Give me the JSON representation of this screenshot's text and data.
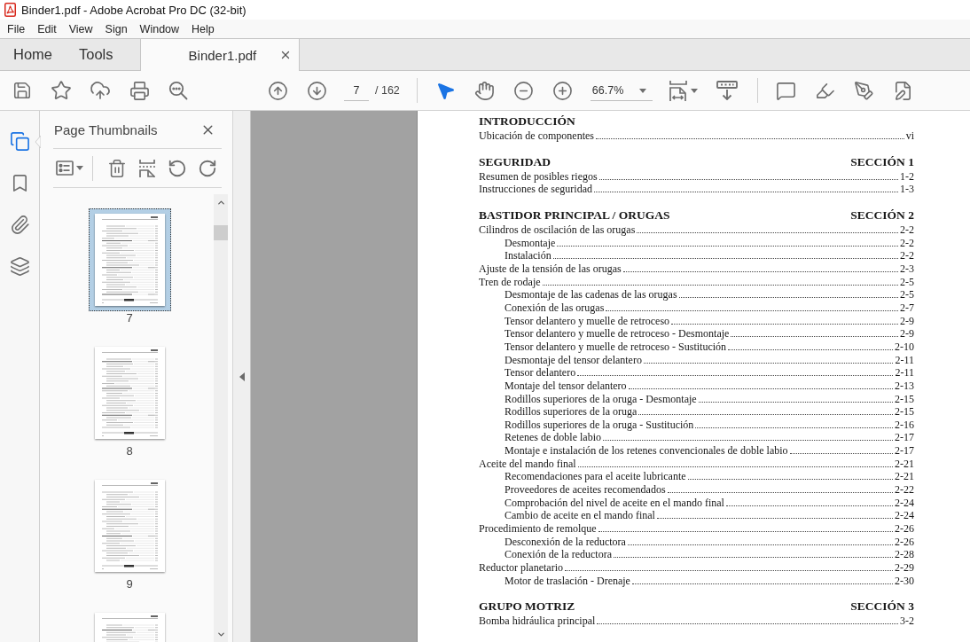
{
  "window": {
    "title": "Binder1.pdf - Adobe Acrobat Pro DC (32-bit)"
  },
  "menu": [
    "File",
    "Edit",
    "View",
    "Sign",
    "Window",
    "Help"
  ],
  "tabs": [
    {
      "label": "Home",
      "kind": "app",
      "selected": false
    },
    {
      "label": "Tools",
      "kind": "app",
      "selected": false
    },
    {
      "label": "Binder1.pdf",
      "kind": "document",
      "selected": true
    }
  ],
  "toolbar": {
    "tools": [
      {
        "selected": true
      },
      {
        "selected": false
      }
    ],
    "page_field": {
      "value": "7"
    },
    "page_total": "/ 162",
    "zoom_field": {
      "value": "66.7%"
    }
  },
  "nav_rail": [
    {
      "selected": true
    },
    {
      "selected": false
    },
    {
      "selected": false
    },
    {
      "selected": false
    }
  ],
  "thumbnails_panel": {
    "title": "Page Thumbnails",
    "thumbnails": [
      {
        "label": "7",
        "selected": true
      },
      {
        "label": "8",
        "selected": false
      },
      {
        "label": "9",
        "selected": false
      },
      {
        "selected": false
      }
    ]
  },
  "document": {
    "sections": [
      {
        "title": "INTRODUCCIÓN",
        "entries": [
          {
            "text": "Ubicación de componentes",
            "page": "vi"
          }
        ]
      },
      {
        "title": "SEGURIDAD",
        "number": "SECCIÓN 1",
        "entries": [
          {
            "text": "Resumen de posibles riegos",
            "page": "1-2"
          },
          {
            "text": "Instrucciones de seguridad",
            "page": "1-3"
          }
        ]
      },
      {
        "title": "BASTIDOR PRINCIPAL / ORUGAS",
        "number": "SECCIÓN 2",
        "entries": [
          {
            "text": "Cilindros de oscilación de las orugas",
            "page": "2-2",
            "children": [
              {
                "text": "Desmontaje",
                "page": "2-2"
              },
              {
                "text": "Instalación",
                "page": "2-2"
              }
            ]
          },
          {
            "text": "Ajuste de la tensión de las orugas",
            "page": "2-3"
          },
          {
            "text": "Tren de rodaje",
            "page": "2-5",
            "children": [
              {
                "text": "Desmontaje de las cadenas de las orugas",
                "page": "2-5"
              },
              {
                "text": "Conexión de las orugas",
                "page": "2-7"
              },
              {
                "text": "Tensor delantero y muelle de retroceso",
                "page": "2-9"
              },
              {
                "text": "Tensor delantero y muelle de retroceso - Desmontaje",
                "page": "2-9"
              },
              {
                "text": "Tensor delantero y muelle de retroceso - Sustitución",
                "page": "2-10"
              },
              {
                "text": "Desmontaje del tensor delantero",
                "page": "2-11"
              },
              {
                "text": "Tensor delantero",
                "page": "2-11"
              },
              {
                "text": "Montaje del tensor delantero",
                "page": "2-13"
              },
              {
                "text": "Rodillos superiores de la oruga - Desmontaje",
                "page": "2-15"
              },
              {
                "text": "Rodillos superiores de la oruga",
                "page": "2-15"
              },
              {
                "text": "Rodillos superiores de la oruga - Sustitución",
                "page": "2-16"
              },
              {
                "text": "Retenes de doble labio",
                "page": "2-17"
              },
              {
                "text": "Montaje e instalación de los retenes convencionales de doble labio",
                "page": "2-17"
              }
            ]
          },
          {
            "text": "Aceite del mando final",
            "page": "2-21",
            "children": [
              {
                "text": "Recomendaciones para el aceite lubricante",
                "page": "2-21"
              },
              {
                "text": "Proveedores de aceites recomendados",
                "page": "2-22"
              },
              {
                "text": "Comprobación del nivel de aceite en el mando final",
                "page": "2-24"
              },
              {
                "text": "Cambio de aceite en el mando final",
                "page": "2-24"
              }
            ]
          },
          {
            "text": "Procedimiento de remolque",
            "page": "2-26",
            "children": [
              {
                "text": "Desconexión de la reductora",
                "page": "2-26"
              },
              {
                "text": "Conexión de la reductora",
                "page": "2-28"
              }
            ]
          },
          {
            "text": "Reductor planetario",
            "page": "2-29",
            "children": [
              {
                "text": "Motor de traslación - Drenaje",
                "page": "2-30"
              }
            ]
          }
        ]
      },
      {
        "title": "GRUPO MOTRIZ",
        "number": "SECCIÓN 3",
        "entries": [
          {
            "text": "Bomba hidráulica principal",
            "page": "3-2"
          }
        ]
      }
    ]
  }
}
